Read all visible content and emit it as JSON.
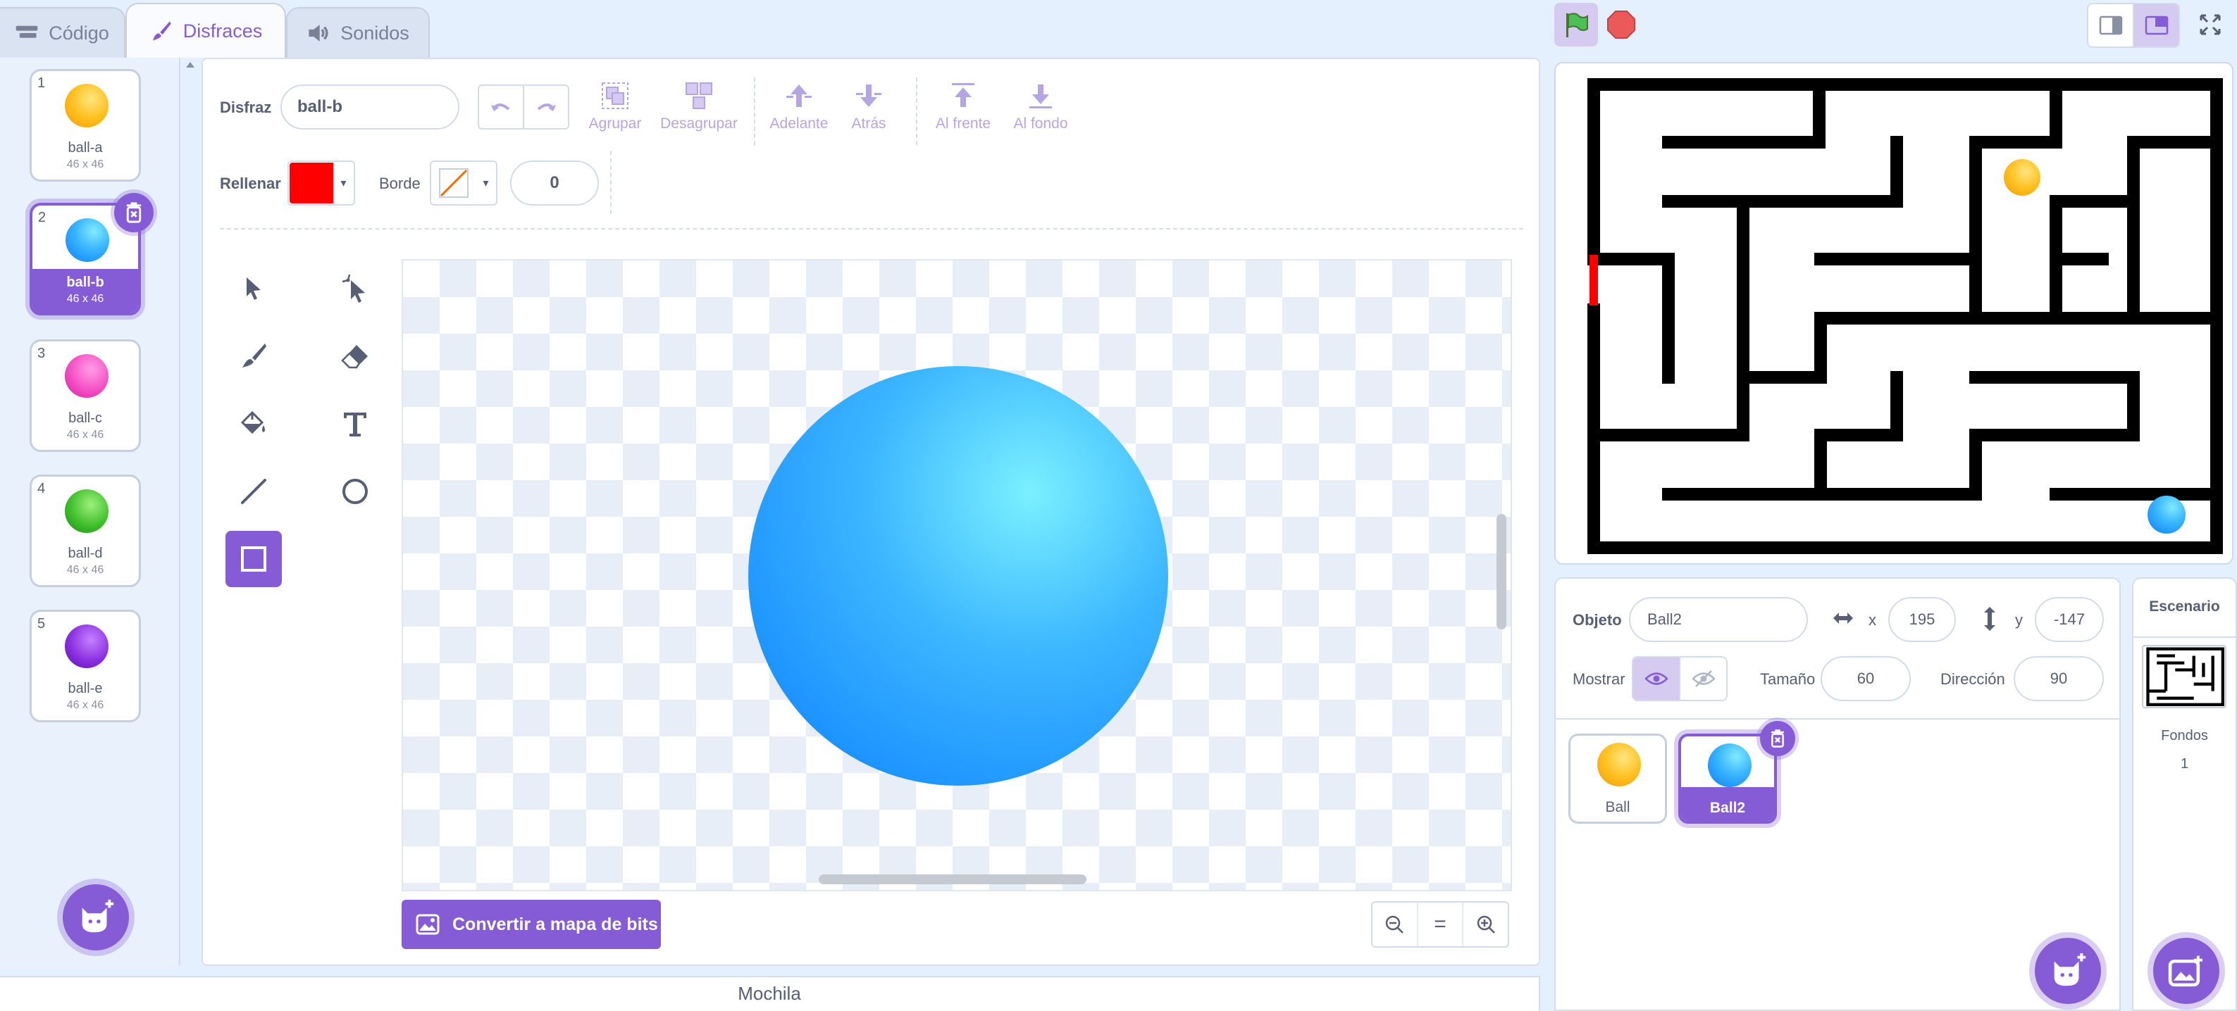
{
  "tabs": [
    {
      "label": "Código"
    },
    {
      "label": "Disfraces"
    },
    {
      "label": "Sonidos"
    }
  ],
  "costumes": [
    {
      "num": "1",
      "name": "ball-a",
      "size": "46 x 46",
      "color": "#ffc020"
    },
    {
      "num": "2",
      "name": "ball-b",
      "size": "46 x 46",
      "color": "#38b4ff"
    },
    {
      "num": "3",
      "name": "ball-c",
      "size": "46 x 46",
      "color": "#f34fc4"
    },
    {
      "num": "4",
      "name": "ball-d",
      "size": "46 x 46",
      "color": "#3fbf2c"
    },
    {
      "num": "5",
      "name": "ball-e",
      "size": "46 x 46",
      "color": "#8a30e0"
    }
  ],
  "editor": {
    "costume_label": "Disfraz",
    "costume_name": "ball-b",
    "group_label": "Agrupar",
    "ungroup_label": "Desagrupar",
    "forward_label": "Adelante",
    "backward_label": "Atrás",
    "front_label": "Al frente",
    "back_label": "Al fondo",
    "fill_label": "Rellenar",
    "fill_color": "#ff0000",
    "outline_label": "Borde",
    "outline_width": "0",
    "convert_label": "Convertir a mapa de bits",
    "zoom_reset": "="
  },
  "backpack": "Mochila",
  "sprite_info": {
    "sprite_label": "Objeto",
    "sprite_name": "Ball2",
    "x_label": "x",
    "x_value": "195",
    "y_label": "y",
    "y_value": "-147",
    "show_label": "Mostrar",
    "size_label": "Tamaño",
    "size_value": "60",
    "direction_label": "Dirección",
    "direction_value": "90"
  },
  "sprites": [
    {
      "name": "Ball"
    },
    {
      "name": "Ball2"
    }
  ],
  "stage_panel": {
    "title": "Escenario",
    "backdrops_label": "Fondos",
    "backdrops_count": "1"
  },
  "colors": {
    "accent": "#855cd6",
    "background": "#e5f0ff"
  }
}
